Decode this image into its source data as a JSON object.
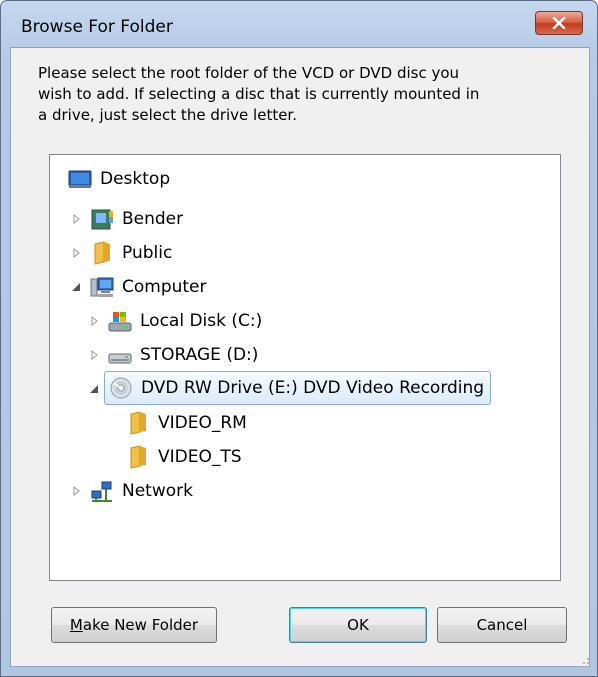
{
  "window": {
    "title": "Browse For Folder"
  },
  "description": [
    "Please select the root folder of the VCD or DVD disc you",
    "wish to add.  If selecting a disc that is currently mounted in",
    "a drive, just select the drive letter."
  ],
  "tree": {
    "desktop": "Desktop",
    "bender": "Bender",
    "public": "Public",
    "computer": "Computer",
    "local_disk": "Local Disk (C:)",
    "storage": "STORAGE (D:)",
    "dvd": "DVD RW Drive (E:) DVD Video Recording",
    "video_rm": "VIDEO_RM",
    "video_ts": "VIDEO_TS",
    "network": "Network"
  },
  "buttons": {
    "make_new_folder_mnemonic": "M",
    "make_new_folder_rest": "ake New Folder",
    "ok": "OK",
    "cancel": "Cancel"
  }
}
